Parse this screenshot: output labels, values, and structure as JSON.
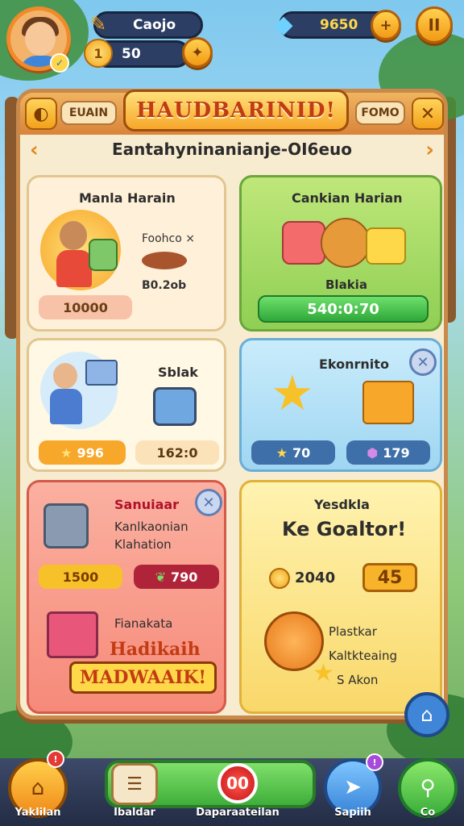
{
  "hud": {
    "name": "Caojo",
    "coins": "50",
    "gems": "9650"
  },
  "panel": {
    "tab_left": "EUAIN",
    "title": "HAUDBARINID!",
    "tab_right": "FOMO",
    "subtitle": "Eantahyninanianje-OI6euo"
  },
  "cards": {
    "c1": {
      "title": "Manla Harain",
      "item": "Foohco ×",
      "value": "B0.2ob",
      "chip": "10000"
    },
    "c2": {
      "title": "Cankian Harian",
      "label": "Blakia",
      "button": "540:0:70"
    },
    "c3": {
      "title": "Sblak",
      "chip_star": "996",
      "chip_plain": "162:0"
    },
    "c4": {
      "title": "Ekonrnito",
      "chip_star": "70",
      "chip_gem": "179"
    },
    "c5": {
      "title": "Sanuiaar",
      "line1": "Kanlkaonian",
      "line2": "Klahation",
      "chip_gold": "1500",
      "chip_red": "790",
      "gift_label": "Fianakata",
      "banner1": "Hadikaih",
      "banner2": "MADWAAIK!"
    },
    "c6": {
      "title1": "Yesdkla",
      "title2": "Ke Goaltor!",
      "coin_value": "2040",
      "badge": "45",
      "text1": "Plastkar",
      "text2": "Kaltkteaing",
      "text3": "S Akon"
    }
  },
  "bottom": {
    "nav1": "Yaklilan",
    "nav2": "Ibaldar",
    "center_badge": "00",
    "nav3": "Daparaateilan",
    "nav4": "Sapiih",
    "nav5": "Co"
  }
}
